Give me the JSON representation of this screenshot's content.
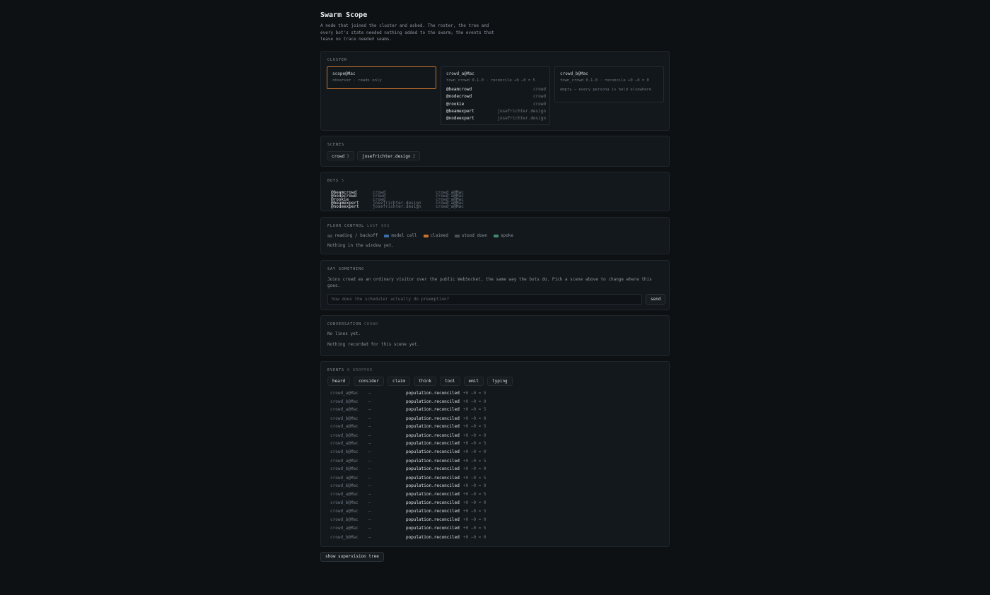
{
  "app": {
    "title": "Swarm Scope",
    "intro": "A node that joined the cluster and asked. The roster, the tree and every bot's state needed nothing added to the swarm; the events that leave no trace needed seams."
  },
  "cluster": {
    "title": "CLUSTER",
    "nodes": [
      {
        "name": "scope@Mac",
        "sub": "observer · reads only",
        "selected": true
      },
      {
        "name": "crowd_a@Mac",
        "sub": "town_crowd 0.1.0 · reconcile +0 −0 = 5",
        "roster": [
          {
            "handle": "@beamcrowd",
            "scene": "crowd"
          },
          {
            "handle": "@nodecrowd",
            "scene": "crowd"
          },
          {
            "handle": "@rookie",
            "scene": "crowd"
          },
          {
            "handle": "@beamexpert",
            "scene": "josefrichter.design"
          },
          {
            "handle": "@nodeexpert",
            "scene": "josefrichter.design"
          }
        ]
      },
      {
        "name": "crowd_b@Mac",
        "sub": "town_crowd 0.1.0 · reconcile +0 −0 = 0",
        "empty": "empty — every persona is held elsewhere"
      }
    ]
  },
  "scenes": {
    "title": "SCENES",
    "items": [
      {
        "name": "crowd",
        "count": "3"
      },
      {
        "name": "josefrichter.design",
        "count": "2"
      }
    ]
  },
  "bots": {
    "title": "BOTS",
    "count": "5",
    "rows": [
      {
        "handle": "@beamcrowd",
        "scene": "crowd",
        "node": "crowd_a@Mac"
      },
      {
        "handle": "@nodecrowd",
        "scene": "crowd",
        "node": "crowd_a@Mac"
      },
      {
        "handle": "@rookie",
        "scene": "crowd",
        "node": "crowd_a@Mac"
      },
      {
        "handle": "@beamexpert",
        "scene": "josefrichter.design",
        "node": "crowd_a@Mac"
      },
      {
        "handle": "@nodeexpert",
        "scene": "josefrichter.design",
        "node": "crowd_a@Mac"
      }
    ]
  },
  "floor": {
    "title": "FLOOR CONTROL",
    "subtitle": "LAST 60S",
    "legend": [
      {
        "label": "reading / backoff",
        "color": "#3a4148"
      },
      {
        "label": "model call",
        "color": "#3f6fa8"
      },
      {
        "label": "claimed",
        "color": "#c8742d"
      },
      {
        "label": "stood down",
        "color": "#4a5258"
      },
      {
        "label": "spoke",
        "color": "#3f8a6e"
      }
    ],
    "empty": "Nothing in the window yet."
  },
  "say": {
    "title": "SAY SOMETHING",
    "description": "Joins crowd as an ordinary visitor over the public WebSocket, the same way the bots do. Pick a scene above to change where this goes.",
    "placeholder": "how does the scheduler actually do preemption?",
    "send_label": "send"
  },
  "conversation": {
    "title": "CONVERSATION",
    "scene": "CROWD",
    "empty_lines": "No lines yet.",
    "empty_record": "Nothing recorded for this scene yet."
  },
  "events": {
    "title": "EVENTS",
    "dropped": "0 DROPPED",
    "filters": [
      "heard",
      "consider",
      "claim",
      "think",
      "tool",
      "emit",
      "typing"
    ],
    "rows": [
      {
        "node": "crowd_a@Mac",
        "dash": "—",
        "kind": "population.reconciled",
        "value": "+0 −0 = 5"
      },
      {
        "node": "crowd_b@Mac",
        "dash": "—",
        "kind": "population.reconciled",
        "value": "+0 −0 = 0"
      },
      {
        "node": "crowd_a@Mac",
        "dash": "—",
        "kind": "population.reconciled",
        "value": "+0 −0 = 5"
      },
      {
        "node": "crowd_b@Mac",
        "dash": "—",
        "kind": "population.reconciled",
        "value": "+0 −0 = 0"
      },
      {
        "node": "crowd_a@Mac",
        "dash": "—",
        "kind": "population.reconciled",
        "value": "+0 −0 = 5"
      },
      {
        "node": "crowd_b@Mac",
        "dash": "—",
        "kind": "population.reconciled",
        "value": "+0 −0 = 0"
      },
      {
        "node": "crowd_a@Mac",
        "dash": "—",
        "kind": "population.reconciled",
        "value": "+0 −0 = 5"
      },
      {
        "node": "crowd_b@Mac",
        "dash": "—",
        "kind": "population.reconciled",
        "value": "+0 −0 = 0"
      },
      {
        "node": "crowd_a@Mac",
        "dash": "—",
        "kind": "population.reconciled",
        "value": "+0 −0 = 5"
      },
      {
        "node": "crowd_b@Mac",
        "dash": "—",
        "kind": "population.reconciled",
        "value": "+0 −0 = 0"
      },
      {
        "node": "crowd_a@Mac",
        "dash": "—",
        "kind": "population.reconciled",
        "value": "+0 −0 = 5"
      },
      {
        "node": "crowd_b@Mac",
        "dash": "—",
        "kind": "population.reconciled",
        "value": "+0 −0 = 0"
      },
      {
        "node": "crowd_a@Mac",
        "dash": "—",
        "kind": "population.reconciled",
        "value": "+0 −0 = 5"
      },
      {
        "node": "crowd_b@Mac",
        "dash": "—",
        "kind": "population.reconciled",
        "value": "+0 −0 = 0"
      },
      {
        "node": "crowd_a@Mac",
        "dash": "—",
        "kind": "population.reconciled",
        "value": "+0 −0 = 5"
      },
      {
        "node": "crowd_b@Mac",
        "dash": "—",
        "kind": "population.reconciled",
        "value": "+0 −0 = 0"
      },
      {
        "node": "crowd_a@Mac",
        "dash": "—",
        "kind": "population.reconciled",
        "value": "+0 −0 = 5"
      },
      {
        "node": "crowd_b@Mac",
        "dash": "—",
        "kind": "population.reconciled",
        "value": "+0 −0 = 0"
      }
    ]
  },
  "tree_button": "show supervision tree"
}
